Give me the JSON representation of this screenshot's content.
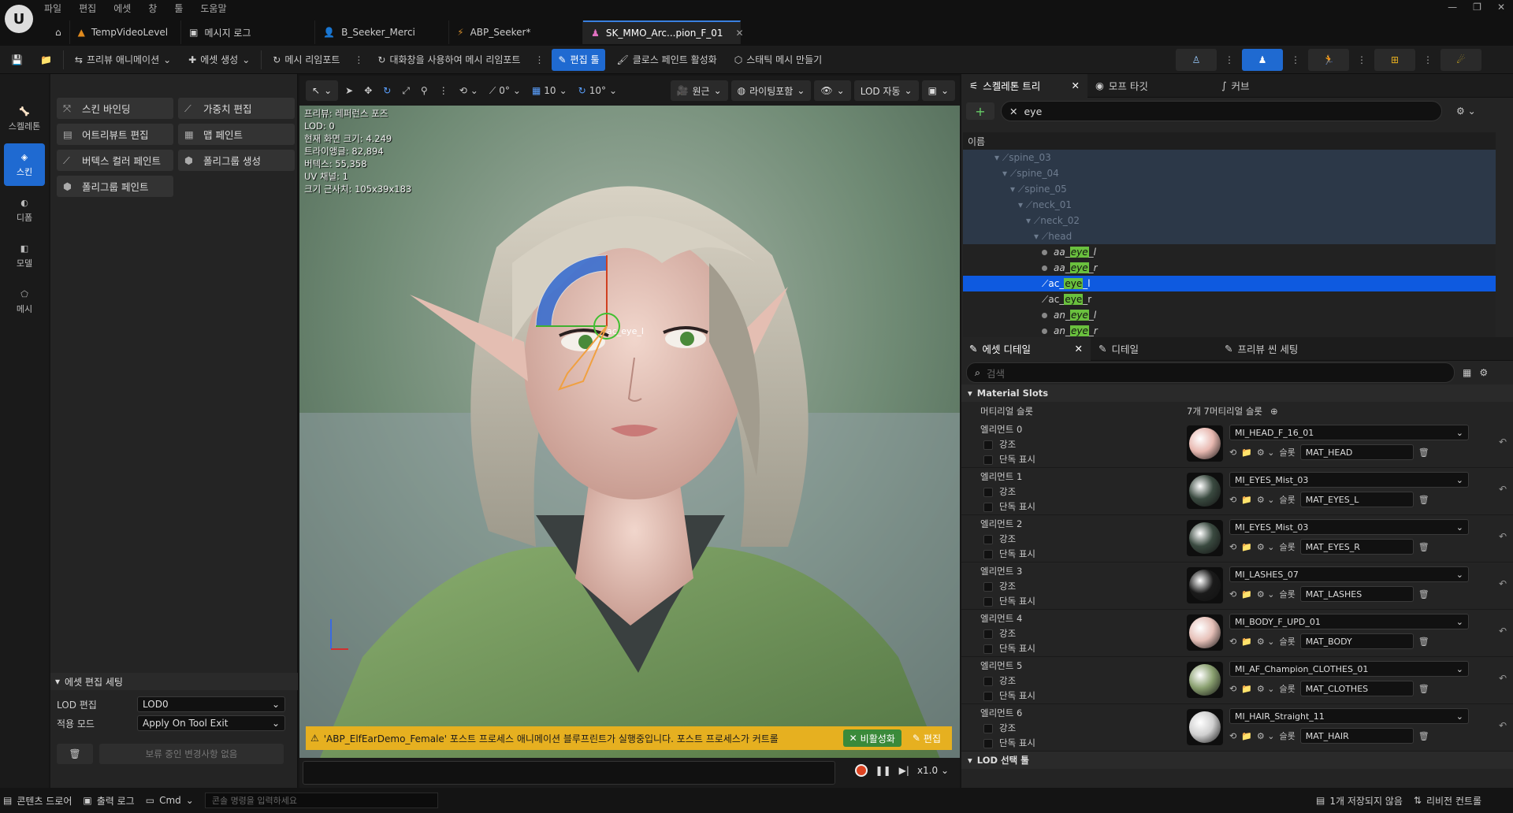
{
  "menu": [
    "파일",
    "편집",
    "에셋",
    "창",
    "툴",
    "도움말"
  ],
  "tabs": [
    {
      "label": "TempVideoLevel",
      "icon": "level-icon"
    },
    {
      "label": "메시지 로그",
      "icon": "log-icon"
    },
    {
      "label": "B_Seeker_Merci",
      "icon": "blueprint-icon"
    },
    {
      "label": "ABP_Seeker*",
      "icon": "anim-blueprint-icon"
    },
    {
      "label": "SK_MMO_Arc...pion_F_01",
      "icon": "skeletal-mesh-icon"
    }
  ],
  "toolbar": {
    "preview_anim": "프리뷰 애니메이션",
    "create_asset": "에셋 생성",
    "reimport": "메시 리임포트",
    "reimport_dialog": "대화창을 사용하여 메시 리임포트",
    "edit_tool": "편집 툴",
    "cloth_paint": "클로스 페인트 활성화",
    "make_static": "스태틱 메시 만들기"
  },
  "modes": [
    {
      "label": "스켈레톤",
      "icon": "skeleton-icon"
    },
    {
      "label": "스킨",
      "icon": "skin-icon"
    },
    {
      "label": "디폼",
      "icon": "deform-icon"
    },
    {
      "label": "모델",
      "icon": "model-icon"
    },
    {
      "label": "메시",
      "icon": "mesh-icon"
    }
  ],
  "tools": [
    {
      "label": "스킨 바인딩",
      "icon": "skin-binding-icon"
    },
    {
      "label": "가중치 편집",
      "icon": "weight-edit-icon"
    },
    {
      "label": "어트리뷰트 편집",
      "icon": "attribute-edit-icon"
    },
    {
      "label": "맵 페인트",
      "icon": "map-paint-icon"
    },
    {
      "label": "버텍스 컬러 페인트",
      "icon": "vertex-color-icon"
    },
    {
      "label": "폴리그룹 생성",
      "icon": "polygroup-gen-icon"
    },
    {
      "label": "폴리그룹 페인트",
      "icon": "polygroup-paint-icon"
    }
  ],
  "asset_settings": {
    "title": "에셋 편집 세팅",
    "lod_label": "LOD 편집",
    "lod_value": "LOD0",
    "apply_label": "적용 모드",
    "apply_value": "Apply On Tool Exit",
    "pending": "보류 중인 변경사항 없음"
  },
  "viewport": {
    "angle_snap": "0°",
    "grid": "10",
    "rot_snap": "10°",
    "perspective": "원근",
    "lighting": "라이팅포함",
    "lod": "LOD 자동",
    "stats": [
      "프리뷰: 레퍼런스 포즈",
      "LOD: 0",
      "현재 화면 크기: 4.249",
      "트라이앵글: 82,894",
      "버텍스: 55,358",
      "UV 채널: 1",
      "크기 근사치: 105x39x183"
    ],
    "bone_label": "ac_eye_l",
    "warning": "'ABP_ElfEarDemo_Female' 포스트 프로세스 애니메이션 블루프린트가 실행중입니다. 포스트 프로세스가 커트롤",
    "disable_btn": "비활성화",
    "edit_btn": "편집",
    "speed": "x1.0"
  },
  "right_tabs": {
    "skeleton_tree": "스켈레톤 트리",
    "morph": "모프 타깃",
    "curve": "커브"
  },
  "search": {
    "value": "eye"
  },
  "tree": {
    "header": "이름",
    "rows": [
      {
        "name": "spine_03",
        "indent": 0,
        "kind": "dim",
        "pre": "",
        "hl": "",
        "post": ""
      },
      {
        "name": "spine_04",
        "indent": 1,
        "kind": "dim"
      },
      {
        "name": "spine_05",
        "indent": 2,
        "kind": "dim"
      },
      {
        "name": "neck_01",
        "indent": 3,
        "kind": "dim"
      },
      {
        "name": "neck_02",
        "indent": 4,
        "kind": "dim"
      },
      {
        "name": "head",
        "indent": 5,
        "kind": "dim"
      },
      {
        "pre": "aa_",
        "hl": "eye",
        "post": "_l",
        "indent": 6,
        "kind": "dot"
      },
      {
        "pre": "aa_",
        "hl": "eye",
        "post": "_r",
        "indent": 6,
        "kind": "dot"
      },
      {
        "pre": "ac_",
        "hl": "eye",
        "post": "_l",
        "indent": 6,
        "kind": "bone",
        "selected": true
      },
      {
        "pre": "ac_",
        "hl": "eye",
        "post": "_r",
        "indent": 6,
        "kind": "bone"
      },
      {
        "pre": "an_",
        "hl": "eye",
        "post": "_l",
        "indent": 6,
        "kind": "dot"
      },
      {
        "pre": "an_",
        "hl": "eye",
        "post": "_r",
        "indent": 6,
        "kind": "dot"
      }
    ]
  },
  "details_tabs": {
    "asset_details": "에셋 디테일",
    "details": "디테일",
    "preview_scene": "프리뷰 씬 세팅"
  },
  "details_search_placeholder": "검색",
  "material_slots": {
    "title": "Material Slots",
    "label": "머티리얼 슬롯",
    "count": "7개 7머티리얼 슬롯",
    "highlight": "강조",
    "isolate": "단독 표시",
    "slot_word": "슬롯",
    "elements": [
      {
        "label": "엘리먼트 0",
        "material": "MI_HEAD_F_16_01",
        "slot": "MAT_HEAD",
        "color": "#e8b8b0"
      },
      {
        "label": "엘리먼트 1",
        "material": "MI_EYES_Mist_03",
        "slot": "MAT_EYES_L",
        "color": "#3a4a40"
      },
      {
        "label": "엘리먼트 2",
        "material": "MI_EYES_Mist_03",
        "slot": "MAT_EYES_R",
        "color": "#3a4a40"
      },
      {
        "label": "엘리먼트 3",
        "material": "MI_LASHES_07",
        "slot": "MAT_LASHES",
        "color": "#1a1a1a"
      },
      {
        "label": "엘리먼트 4",
        "material": "MI_BODY_F_UPD_01",
        "slot": "MAT_BODY",
        "color": "#e6c0b8"
      },
      {
        "label": "엘리먼트 5",
        "material": "MI_AF_Champion_CLOTHES_01",
        "slot": "MAT_CLOTHES",
        "color": "#8aa070"
      },
      {
        "label": "엘리먼트 6",
        "material": "MI_HAIR_Straight_11",
        "slot": "MAT_HAIR",
        "color": "#d0d0d0"
      }
    ]
  },
  "lod_picker": "LOD 선택 툴",
  "status": {
    "content_drawer": "콘텐츠 드로어",
    "output_log": "출력 로그",
    "cmd": "Cmd",
    "cmd_placeholder": "콘솔 명령을 입력하세요",
    "unsaved": "1개 저장되지 않음",
    "revision": "리비전 컨트롤"
  }
}
